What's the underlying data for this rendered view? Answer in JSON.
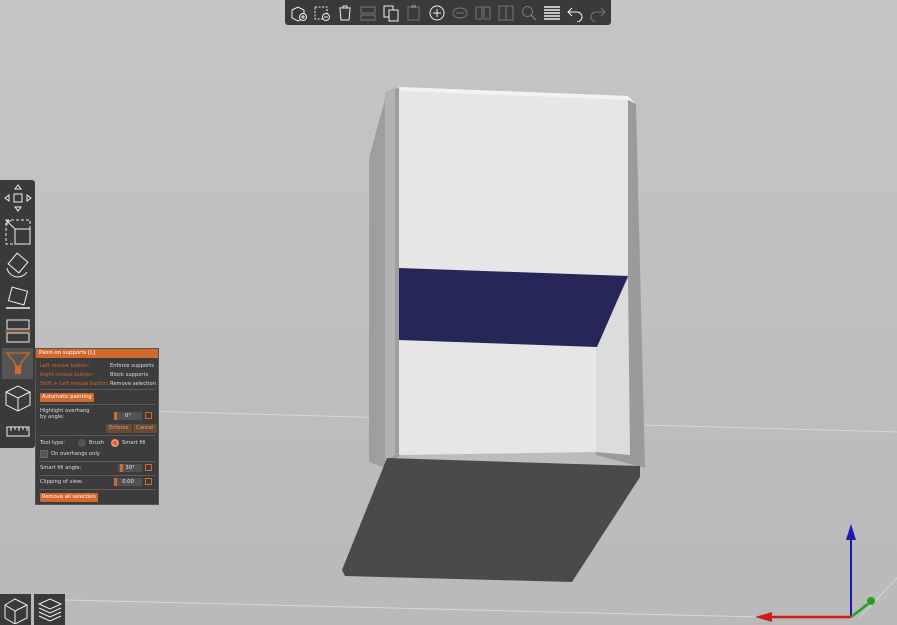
{
  "panel": {
    "title": "Paint-on supports [L]",
    "mouse_hints": [
      {
        "action": "Left mouse button:",
        "result": "Enforce supports"
      },
      {
        "action": "Right mouse button:",
        "result": "Block supports"
      },
      {
        "action": "Shift + Left mouse button:",
        "result": "Remove selection"
      }
    ],
    "automatic_painting": "Automatic painting",
    "highlight_label_1": "Highlight overhang",
    "highlight_label_2": "by angle:",
    "highlight_value": "0°",
    "enforce_label": "Enforce",
    "cancel_label": "Cancel",
    "tool_type_label": "Tool type:",
    "brush_label": "Brush",
    "smart_fill_label": "Smart fill",
    "on_overhangs_label": "On overhangs only",
    "smart_fill_angle_label": "Smart fill angle:",
    "smart_fill_angle_value": "30°",
    "clipping_label": "Clipping of view:",
    "clipping_value": "0.00",
    "remove_all_label": "Remove all selection"
  },
  "colors": {
    "accent": "#d2692c",
    "painted_face": "#262658",
    "toolbar_bg": "#3a3a3a",
    "panel_bg": "#3c3c3c",
    "axis_x": "#d31919",
    "axis_y": "#1fa31f",
    "axis_z": "#1a1ab0"
  },
  "top_toolbar_icons": [
    "add-icon",
    "delete-icon",
    "delete-all-icon",
    "arrange-icon",
    "copy-icon",
    "paste-icon",
    "add-instance-icon",
    "remove-instance-icon",
    "split-objects-icon",
    "split-parts-icon",
    "search-icon",
    "layers-editing-icon",
    "undo-icon",
    "redo-icon"
  ],
  "left_toolbar_icons": [
    "move-icon",
    "scale-icon",
    "rotate-icon",
    "place-on-face-icon",
    "cut-icon",
    "paint-supports-icon",
    "seam-icon",
    "measure-icon"
  ],
  "view_buttons": [
    "3d-view-icon",
    "preview-layers-icon"
  ]
}
